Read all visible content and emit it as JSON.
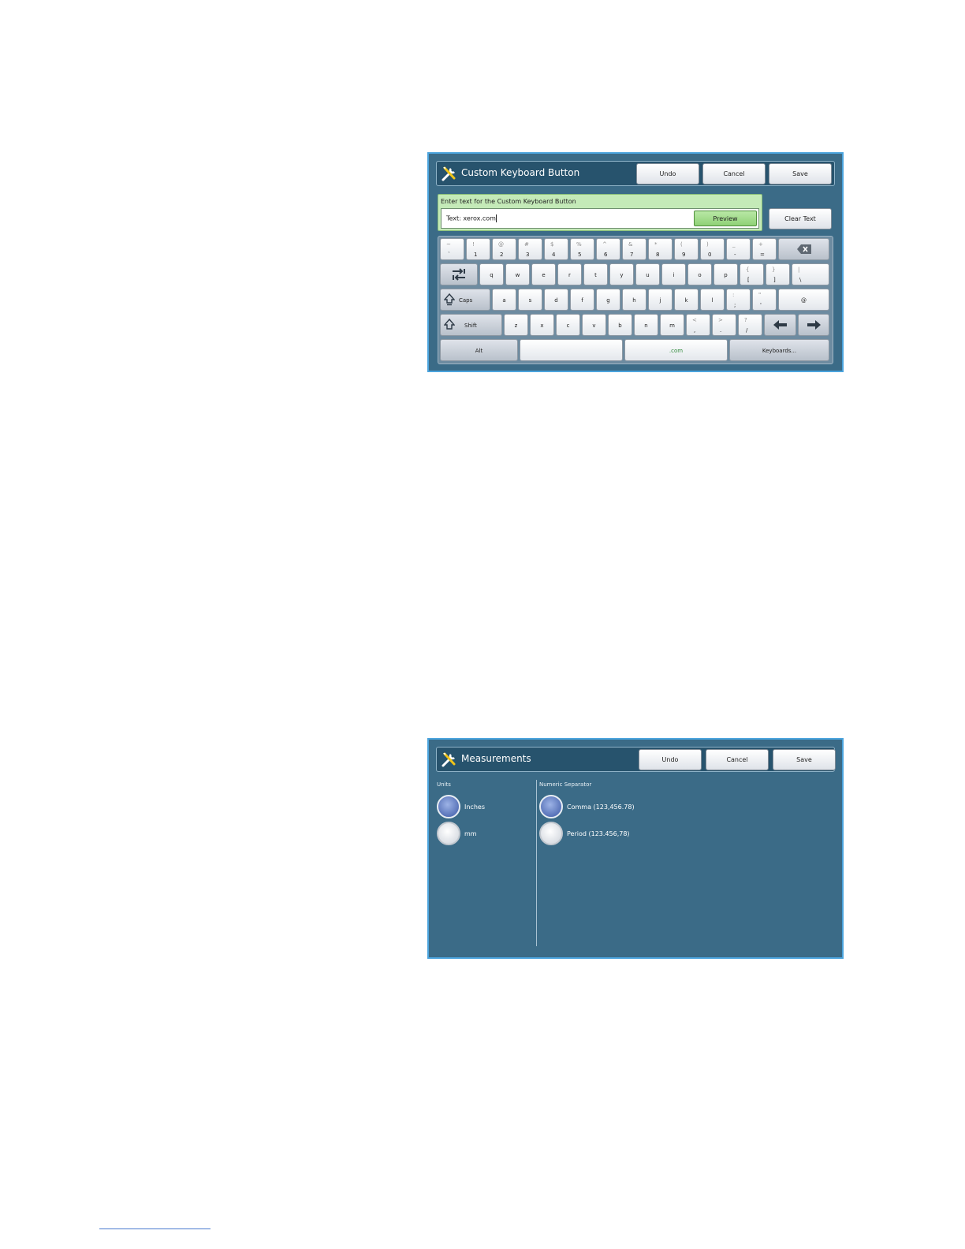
{
  "keyboard_screen": {
    "title": "Custom Keyboard Button",
    "title_icon": "tools-icon",
    "buttons": {
      "undo": "Undo",
      "cancel": "Cancel",
      "save": "Save"
    },
    "entry": {
      "label": "Enter text for the Custom Keyboard Button",
      "value": "Text: xerox.com",
      "preview": "Preview"
    },
    "clear_text": "Clear Text",
    "keys": {
      "row1": [
        {
          "shift": "~",
          "base": "`"
        },
        {
          "shift": "!",
          "base": "1"
        },
        {
          "shift": "@",
          "base": "2"
        },
        {
          "shift": "#",
          "base": "3"
        },
        {
          "shift": "$",
          "base": "4"
        },
        {
          "shift": "%",
          "base": "5"
        },
        {
          "shift": "^",
          "base": "6"
        },
        {
          "shift": "&",
          "base": "7"
        },
        {
          "shift": "*",
          "base": "8"
        },
        {
          "shift": "(",
          "base": "9"
        },
        {
          "shift": ")",
          "base": "0"
        },
        {
          "shift": "_",
          "base": "-"
        },
        {
          "shift": "+",
          "base": "="
        }
      ],
      "row2": [
        "q",
        "w",
        "e",
        "r",
        "t",
        "y",
        "u",
        "i",
        "o",
        "p"
      ],
      "row2_extra": [
        {
          "shift": "{",
          "base": "["
        },
        {
          "shift": "}",
          "base": "]"
        },
        {
          "shift": "|",
          "base": "\\"
        }
      ],
      "row3": [
        "a",
        "s",
        "d",
        "f",
        "g",
        "h",
        "j",
        "k",
        "l"
      ],
      "row3_extra": [
        {
          "shift": ":",
          "base": ";"
        },
        {
          "shift": "\"",
          "base": "'"
        }
      ],
      "at": "@",
      "row4": [
        "z",
        "x",
        "c",
        "v",
        "b",
        "n",
        "m"
      ],
      "row4_extra": [
        {
          "shift": "<",
          "base": ","
        },
        {
          "shift": ">",
          "base": "."
        },
        {
          "shift": "?",
          "base": "/"
        }
      ],
      "caps": "Caps",
      "shift": "Shift",
      "alt": "Alt",
      "dotcom": ".com",
      "keyboards": "Keyboards..."
    },
    "icons": {
      "backspace": "backspace-icon",
      "tab": "tab-switch-icon",
      "caps": "caps-arrow-icon",
      "shift": "shift-arrow-icon",
      "left": "arrow-left-icon",
      "right": "arrow-right-icon"
    }
  },
  "measurements_screen": {
    "title": "Measurements",
    "title_icon": "tools-icon",
    "buttons": {
      "undo": "Undo",
      "cancel": "Cancel",
      "save": "Save"
    },
    "units": {
      "label": "Units",
      "options": [
        {
          "label": "Inches",
          "selected": true
        },
        {
          "label": "mm",
          "selected": false
        }
      ]
    },
    "separator": {
      "label": "Numeric Separator",
      "options": [
        {
          "label": "Comma (123,456.78)",
          "selected": true
        },
        {
          "label": "Period (123.456,78)",
          "selected": false
        }
      ]
    }
  },
  "colors": {
    "screen_bg": "#3b6b87",
    "titlebar_bg": "#27536d",
    "screen_border": "#4aa3dd",
    "entry_panel": "#c4eab8",
    "radio_selected": "#5873b9"
  }
}
